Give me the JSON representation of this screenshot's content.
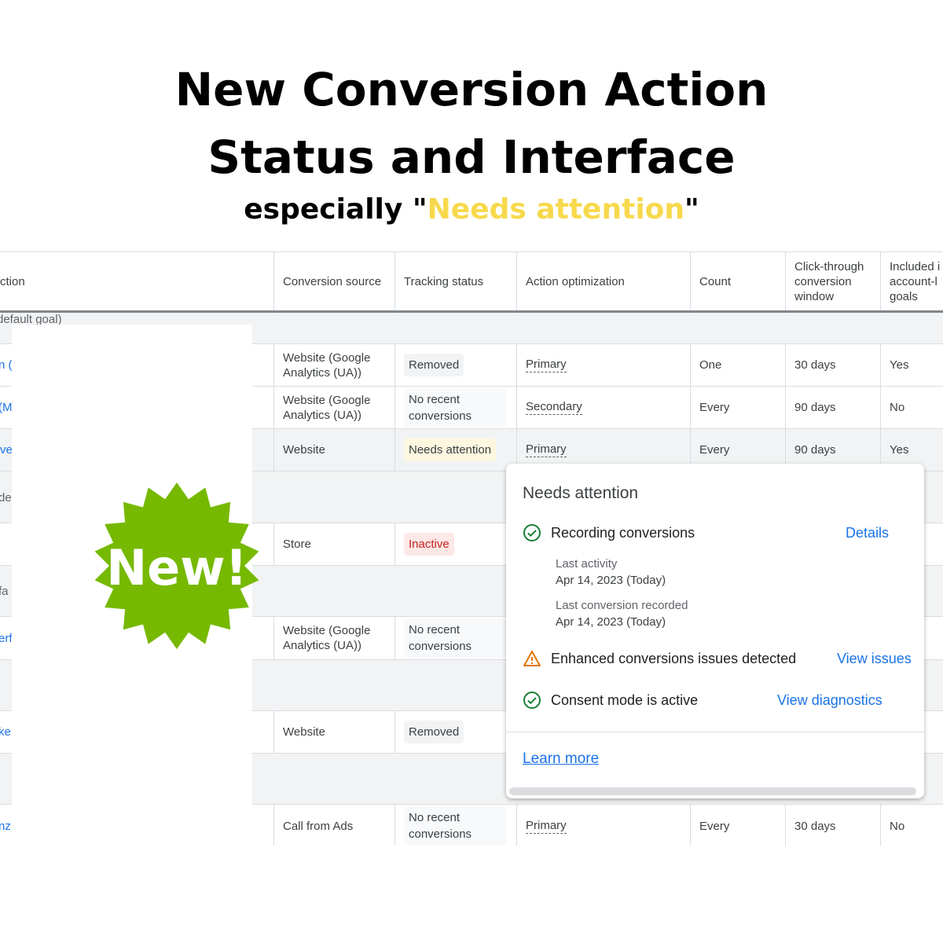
{
  "heading": {
    "line1": "New Conversion Action",
    "line2": "Status and Interface",
    "subtitle_prefix": "especially \"",
    "subtitle_highlight": "Needs attention",
    "subtitle_suffix": "\"",
    "highlight_color": "#f7d94c"
  },
  "table": {
    "headers": [
      "ction",
      "Conversion source",
      "Tracking status",
      "Action optimization",
      "Count",
      "Click-through conversion window",
      "Included i account-l goals"
    ],
    "group_label": "default goal)",
    "rows": [
      {
        "name": "n (I",
        "source": "Website (Google Analytics (UA))",
        "status": "Removed",
        "optimization": "Primary",
        "count": "One",
        "window": "30 days",
        "included": "Yes"
      },
      {
        "name": "(M",
        "source": "Website (Google Analytics (UA))",
        "status": "No recent conversions",
        "optimization": "Secondary",
        "count": "Every",
        "window": "90 days",
        "included": "No"
      },
      {
        "name": "ve",
        "source": "Website",
        "status": "Needs attention",
        "optimization": "Primary",
        "count": "Every",
        "window": "90 days",
        "included": "Yes"
      },
      {
        "name": "",
        "source": "Store",
        "status": "Inactive"
      },
      {
        "name": "erf",
        "source": "Website (Google Analytics (UA))",
        "status": "No recent conversions"
      },
      {
        "name": "ke",
        "source": "Website",
        "status": "Removed"
      },
      {
        "name": "nz",
        "source": "Call from Ads",
        "status": "No recent conversions",
        "optimization": "Primary",
        "count": "Every",
        "window": "30 days",
        "included": "No"
      }
    ],
    "group_fragments": [
      "de",
      "fa"
    ]
  },
  "badge": {
    "text": "New!",
    "color": "#76b900"
  },
  "popup": {
    "title": "Needs attention",
    "recording": {
      "label": "Recording conversions",
      "action": "Details",
      "icon": "check-circle-icon"
    },
    "last_activity_label": "Last activity",
    "last_activity_value": "Apr 14, 2023 (Today)",
    "last_conversion_label": "Last conversion recorded",
    "last_conversion_value": "Apr 14, 2023 (Today)",
    "enhanced": {
      "label": "Enhanced conversions issues detected",
      "action": "View issues",
      "icon": "warning-triangle-icon"
    },
    "consent": {
      "label": "Consent mode is active",
      "action": "View diagnostics",
      "icon": "check-circle-icon"
    },
    "learn_more": "Learn more"
  }
}
